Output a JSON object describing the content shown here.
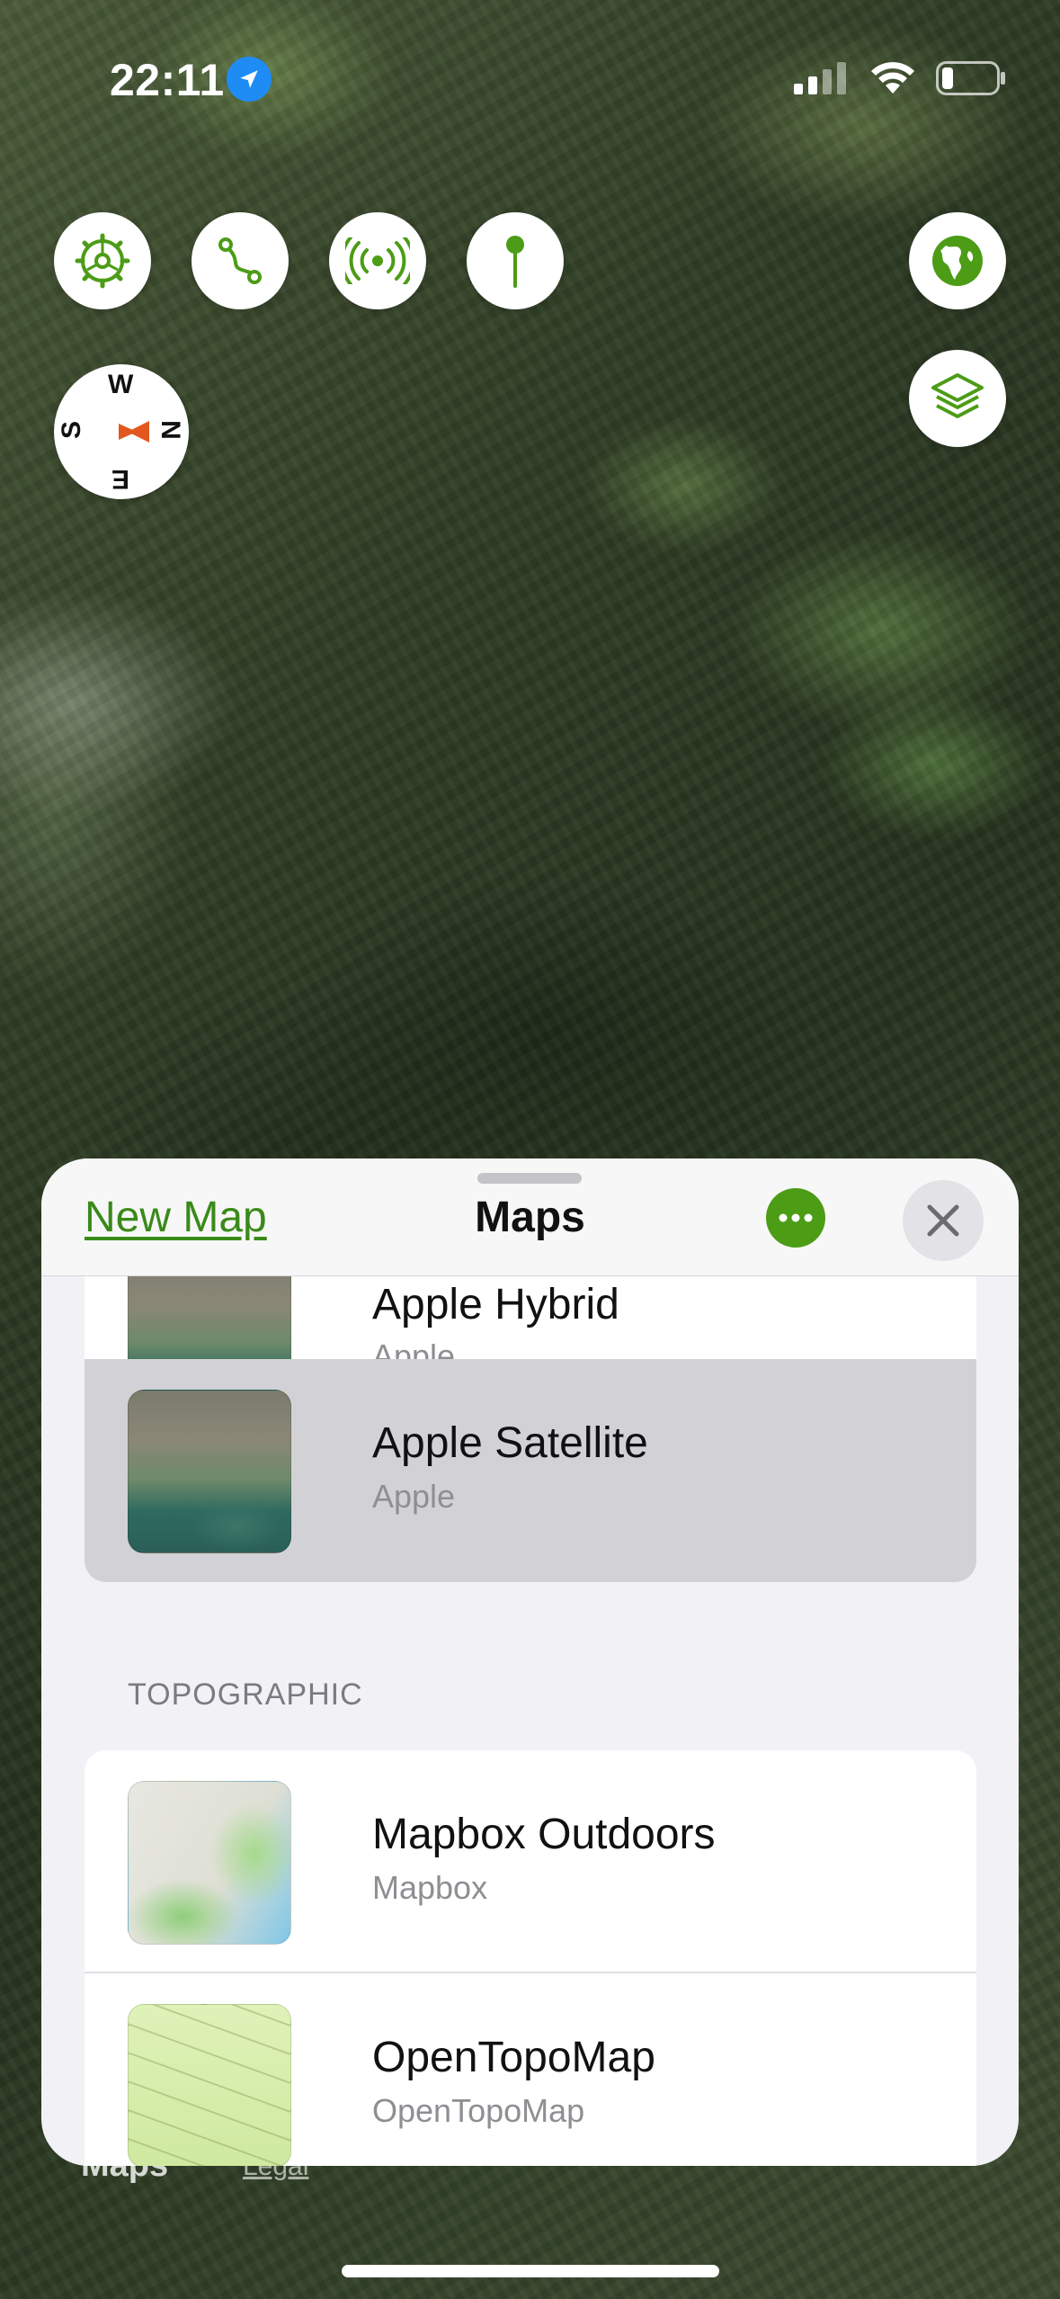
{
  "status_bar": {
    "time": "22:11",
    "icons": [
      "location-arrow-icon",
      "signal-icon",
      "wifi-icon",
      "battery-icon"
    ]
  },
  "map_controls": {
    "buttons": [
      "settings-gear-icon",
      "route-icon",
      "broadcast-icon",
      "pin-icon",
      "globe-icon",
      "layers-icon"
    ],
    "compass": {
      "w": "W",
      "n": "N",
      "s": "S",
      "e": "E"
    }
  },
  "sheet": {
    "new_map_label": "New Map",
    "title": "Maps",
    "rows": [
      {
        "title": "Apple Hybrid",
        "subtitle": "Apple"
      },
      {
        "title": "Apple Satellite",
        "subtitle": "Apple",
        "selected": true
      }
    ],
    "sections": [
      {
        "header": "TOPOGRAPHIC",
        "rows": [
          {
            "title": "Mapbox Outdoors",
            "subtitle": "Mapbox"
          },
          {
            "title": "OpenTopoMap",
            "subtitle": "OpenTopoMap"
          }
        ]
      }
    ]
  },
  "attribution": {
    "brand": "Maps",
    "legal": "Legal"
  },
  "colors": {
    "accent": "#4c9c16",
    "link": "#3a8a1a",
    "selected_row": "#d2d2d6"
  }
}
